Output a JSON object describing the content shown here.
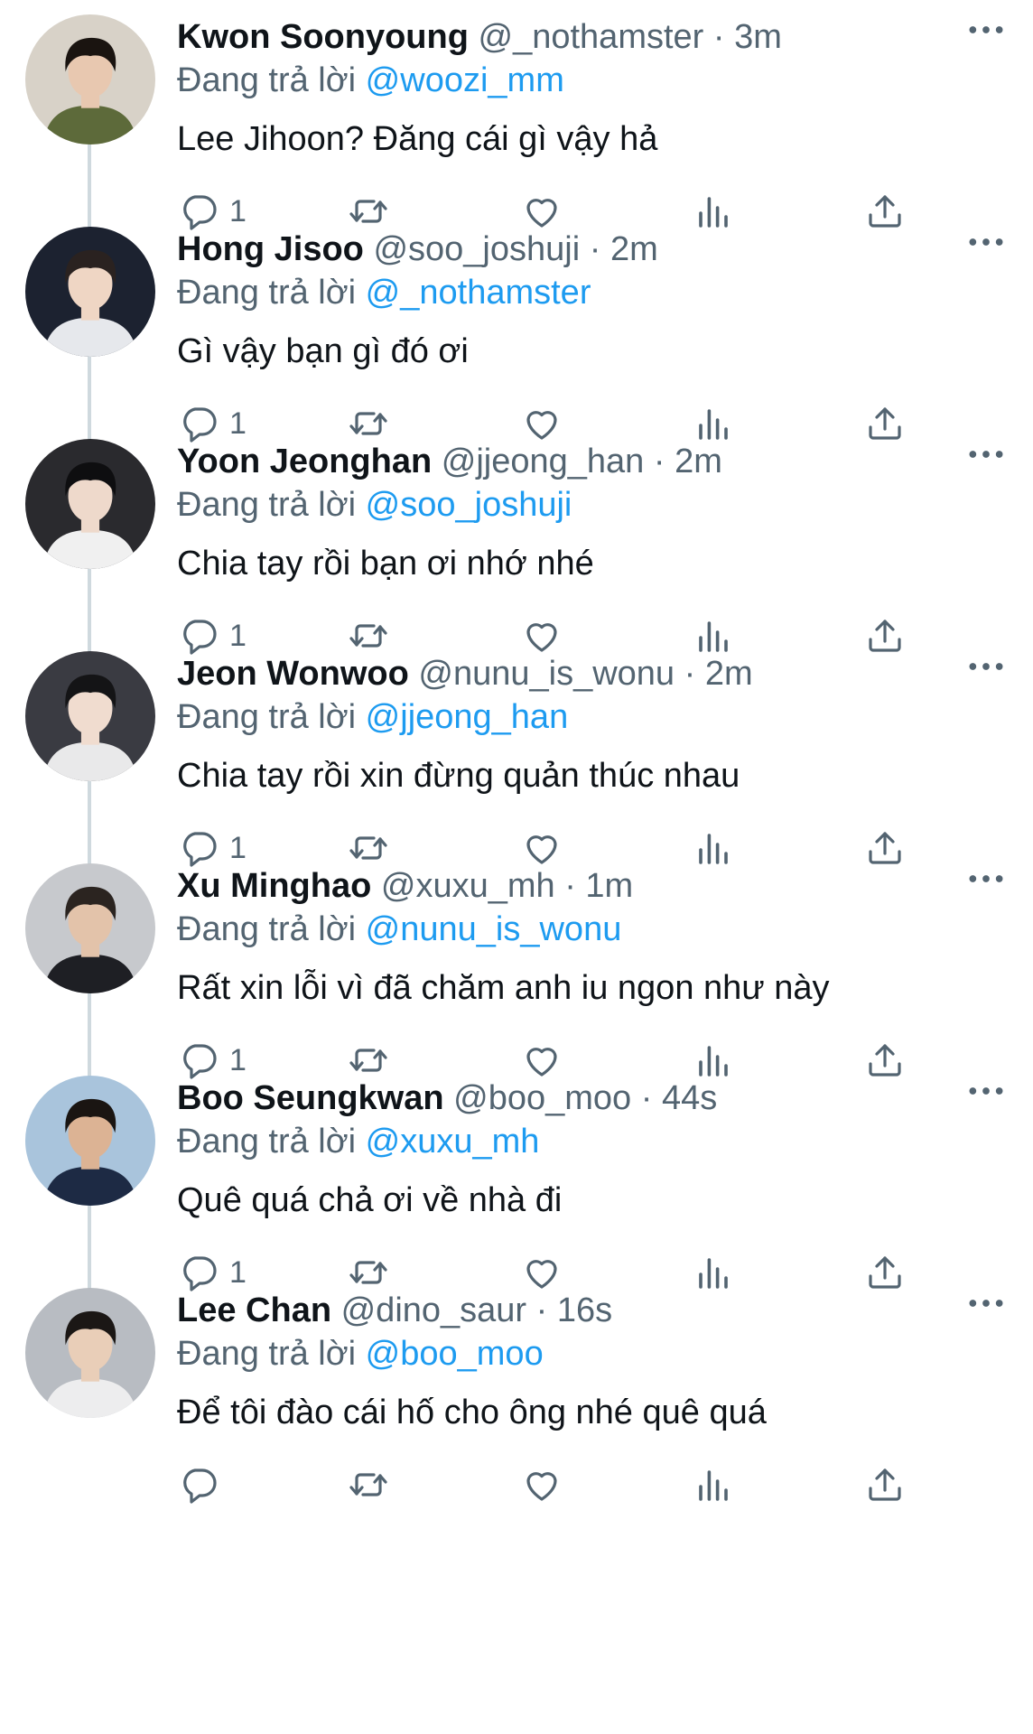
{
  "reply_prefix": "Đang trả lời",
  "colors": {
    "link": "#1d9bf0",
    "secondary_text": "#536471",
    "primary_text": "#0f1419",
    "thread_line": "#cfd9de"
  },
  "icons": {
    "reply": "reply-icon",
    "retweet": "retweet-icon",
    "like": "heart-icon",
    "views": "views-icon",
    "share": "share-icon",
    "more": "more-icon"
  },
  "tweets": [
    {
      "name": "Kwon Soonyoung",
      "handle": "@_nothamster",
      "time": "3m",
      "reply_to": "@woozi_mm",
      "text": "Lee Jihoon? Đăng cái gì vậy hả",
      "reply_count": "1"
    },
    {
      "name": "Hong Jisoo",
      "handle": "@soo_joshuji",
      "time": "2m",
      "reply_to": "@_nothamster",
      "text": "Gì vậy bạn gì đó ơi",
      "reply_count": "1"
    },
    {
      "name": "Yoon Jeonghan",
      "handle": "@jjeong_han",
      "time": "2m",
      "reply_to": "@soo_joshuji",
      "text": "Chia tay rồi bạn ơi nhớ nhé",
      "reply_count": "1"
    },
    {
      "name": "Jeon Wonwoo",
      "handle": "@nunu_is_wonu",
      "time": "2m",
      "reply_to": "@jjeong_han",
      "text": "Chia tay rồi xin đừng quản thúc nhau",
      "reply_count": "1"
    },
    {
      "name": "Xu Minghao",
      "handle": "@xuxu_mh",
      "time": "1m",
      "reply_to": "@nunu_is_wonu",
      "text": "Rất xin lỗi vì đã chăm anh iu ngon như này",
      "reply_count": "1"
    },
    {
      "name": "Boo Seungkwan",
      "handle": "@boo_moo",
      "time": "44s",
      "reply_to": "@xuxu_mh",
      "text": "Quê quá chả ơi về nhà đi",
      "reply_count": "1"
    },
    {
      "name": "Lee Chan",
      "handle": "@dino_saur",
      "time": "16s",
      "reply_to": "@boo_moo",
      "text": "Để tôi đào cái hố cho ông nhé quê quá",
      "reply_count": ""
    }
  ]
}
